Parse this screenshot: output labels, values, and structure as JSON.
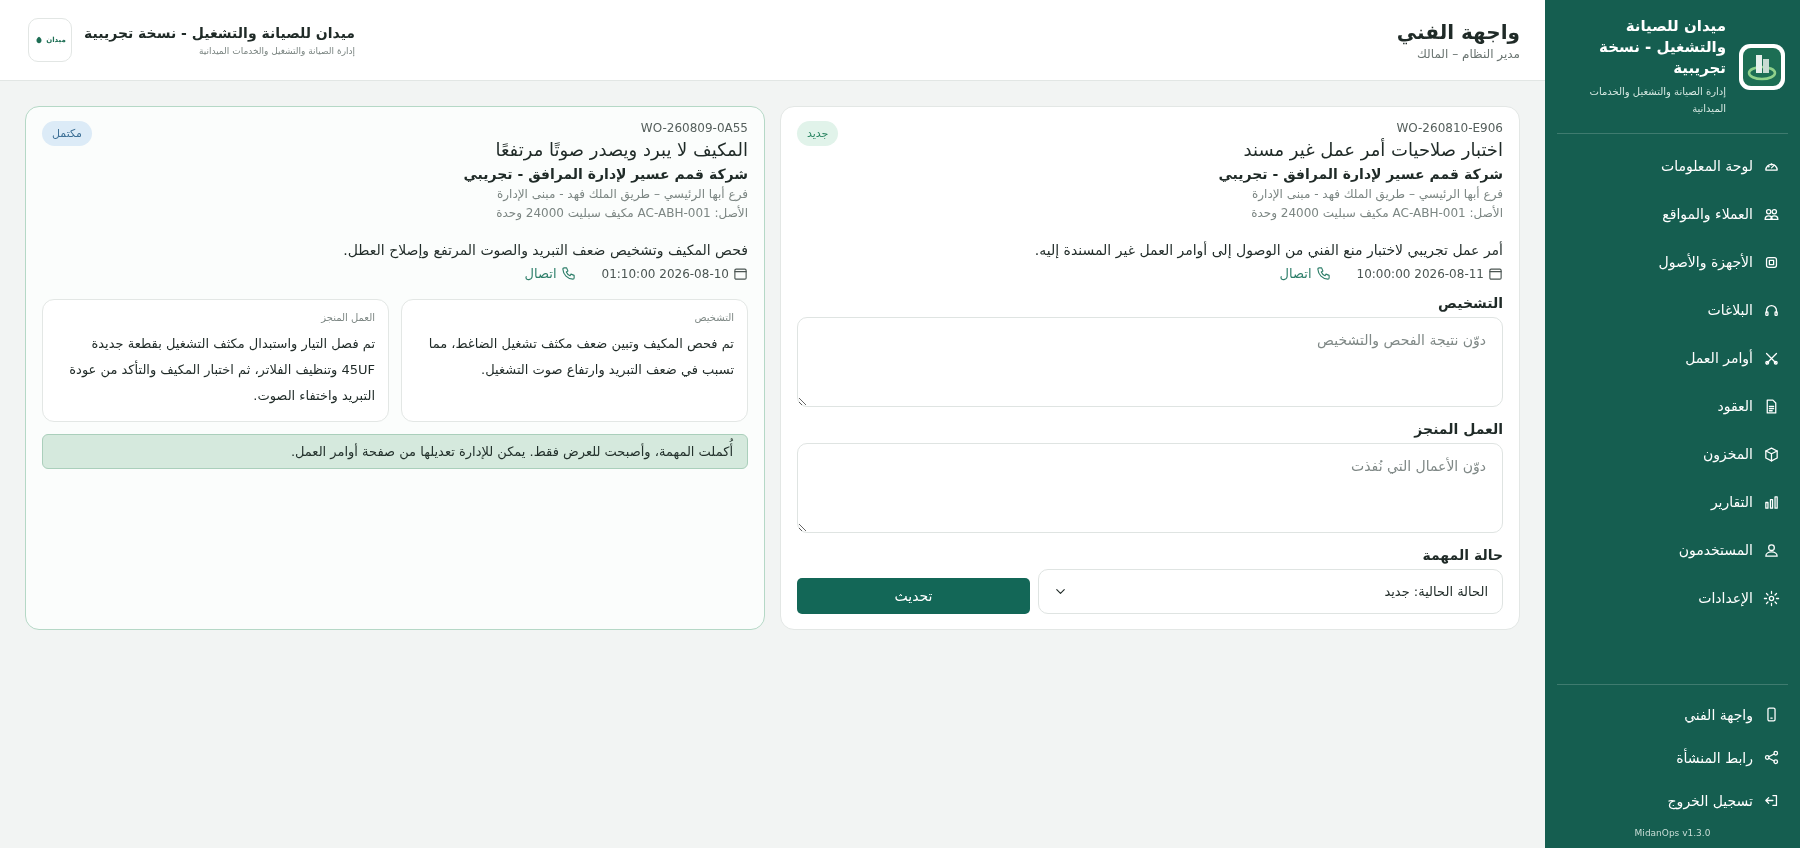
{
  "sidebar": {
    "brand": {
      "title": "ميدان للصيانة والتشغيل - نسخة تجريبية",
      "subtitle": "إدارة الصيانة والتشغيل والخدمات الميدانية"
    },
    "nav_items": [
      {
        "label": "لوحة المعلومات"
      },
      {
        "label": "العملاء والمواقع"
      },
      {
        "label": "الأجهزة والأصول"
      },
      {
        "label": "البلاغات"
      },
      {
        "label": "أوامر العمل"
      },
      {
        "label": "العقود"
      },
      {
        "label": "المخزون"
      },
      {
        "label": "التقارير"
      },
      {
        "label": "المستخدمون"
      },
      {
        "label": "الإعدادات"
      }
    ],
    "footer_items": [
      {
        "label": "واجهة الفني"
      },
      {
        "label": "رابط المنشأة"
      },
      {
        "label": "تسجيل الخروج"
      }
    ],
    "version": "MidanOps v1.3.0"
  },
  "header": {
    "title": "واجهة الفني",
    "subtitle": "مدير النظام – المالك",
    "org": {
      "title": "ميدان للصيانة والتشغيل - نسخة تجريبية",
      "subtitle": "إدارة الصيانة والتشغيل والخدمات الميدانية",
      "logo_text": "ميدان"
    }
  },
  "work_orders": [
    {
      "kind": "form",
      "code": "WO-260810-E906",
      "title": "اختبار صلاحيات أمر عمل غير مسند",
      "customer": "شركة قمم عسير لإدارة المرافق - تجريبي",
      "branch": "فرع أبها الرئيسي – طريق الملك فهد - مبنى الإدارة",
      "asset": "الأصل: AC-ABH-001 مكيف سبليت 24000 وحدة",
      "description": "أمر عمل تجريبي لاختبار منع الفني من الوصول إلى أوامر العمل غير المسندة إليه.",
      "datetime": "2026-08-11 10:00:00",
      "call_label": "اتصال",
      "status": {
        "label": "جديد",
        "kind": "new"
      },
      "form": {
        "fields": [
          {
            "label": "التشخيص",
            "placeholder": "دوّن نتيجة الفحص والتشخيص"
          },
          {
            "label": "العمل المنجز",
            "placeholder": "دوّن الأعمال التي نُفذت"
          }
        ],
        "status_label": "حالة المهمة",
        "status_value": "الحالة الحالية: جديد",
        "submit": "تحديث"
      }
    },
    {
      "kind": "readonly",
      "code": "WO-260809-0A55",
      "title": "المكيف لا يبرد ويصدر صوتًا مرتفعًا",
      "customer": "شركة قمم عسير لإدارة المرافق - تجريبي",
      "branch": "فرع أبها الرئيسي – طريق الملك فهد - مبنى الإدارة",
      "asset": "الأصل: AC-ABH-001 مكيف سبليت 24000 وحدة",
      "description": "فحص المكيف وتشخيص ضعف التبريد والصوت المرتفع وإصلاح العطل.",
      "datetime": "2026-08-10 01:10:00",
      "call_label": "اتصال",
      "status": {
        "label": "مكتمل",
        "kind": "completed"
      },
      "notes": [
        {
          "label": "التشخيص",
          "text": "تم فحص المكيف وتبين ضعف مكثف تشغيل الضاغط، مما تسبب في ضعف التبريد وارتفاع صوت التشغيل."
        },
        {
          "label": "العمل المنجز",
          "text": "تم فصل التيار واستبدال مكثف التشغيل بقطعة جديدة 45UF وتنظيف الفلاتر، ثم اختبار المكيف والتأكد من عودة التبريد واختفاء الصوت."
        }
      ],
      "notice": "أُكملت المهمة، وأصبحت للعرض فقط. يمكن للإدارة تعديلها من صفحة أوامر العمل."
    }
  ]
}
